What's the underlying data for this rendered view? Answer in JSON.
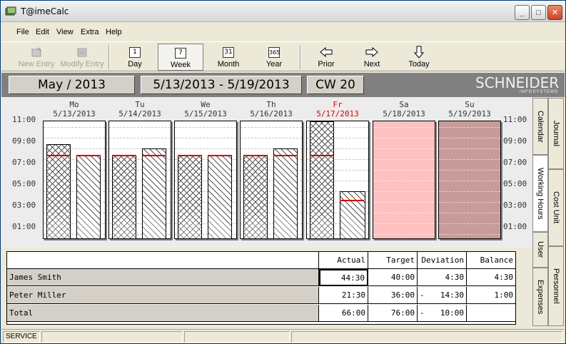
{
  "window": {
    "title": "T@imeCalc"
  },
  "menu": [
    "File",
    "Edit",
    "View",
    "Extra",
    "Help"
  ],
  "toolbar": {
    "new_entry": "New Entry",
    "modify_entry": "Modify Entry",
    "day": "Day",
    "week": "Week",
    "month": "Month",
    "year": "Year",
    "prior": "Prior",
    "next": "Next",
    "today": "Today",
    "day_icon": "1",
    "week_icon": "7",
    "month_icon": "31",
    "year_icon": "365"
  },
  "header": {
    "month": "May / 2013",
    "range": "5/13/2013 - 5/19/2013",
    "cw": "CW 20",
    "logo": "SCHNEIDER",
    "logo_sub": "INFOSYSTEMS"
  },
  "y_axis": [
    "11:00",
    "09:00",
    "07:00",
    "05:00",
    "03:00",
    "01:00"
  ],
  "days": [
    {
      "abbr": "Mo",
      "date": "5/13/2013",
      "actual": 9.0,
      "target": 8.0,
      "today": false,
      "weekend": ""
    },
    {
      "abbr": "Tu",
      "date": "5/14/2013",
      "actual": 8.0,
      "target": 8.0,
      "today": false,
      "weekend": ""
    },
    {
      "abbr": "We",
      "date": "5/15/2013",
      "actual": 8.0,
      "target": 8.0,
      "today": false,
      "weekend": ""
    },
    {
      "abbr": "Th",
      "date": "5/16/2013",
      "actual": 8.0,
      "target": 8.0,
      "today": false,
      "weekend": ""
    },
    {
      "abbr": "Fr",
      "date": "5/17/2013",
      "actual": 11.5,
      "target": 8.0,
      "today": true,
      "weekend": ""
    },
    {
      "abbr": "Sa",
      "date": "5/18/2013",
      "weekend": "sat"
    },
    {
      "abbr": "Su",
      "date": "5/19/2013",
      "weekend": "sun"
    }
  ],
  "side_tabs": {
    "calendar": "Calendar",
    "journal": "Journal",
    "working_hours": "Working Hours",
    "cost_unit": "Cost Unit",
    "user": "User",
    "personnel": "Personnel",
    "expenses": "Expenses"
  },
  "table": {
    "columns": [
      "Actual",
      "Target",
      "Deviation",
      "Balance"
    ],
    "rows": [
      {
        "name": "James Smith",
        "actual": "44:30",
        "target": "40:00",
        "dev_sign": "",
        "deviation": "4:30",
        "balance": "4:30"
      },
      {
        "name": "Peter Miller",
        "actual": "21:30",
        "target": "36:00",
        "dev_sign": "-",
        "deviation": "14:30",
        "balance": "1:00"
      },
      {
        "name": "Total",
        "actual": "66:00",
        "target": "76:00",
        "dev_sign": "-",
        "deviation": "10:00",
        "balance": ""
      }
    ]
  },
  "status": {
    "mode": "SERVICE"
  },
  "colors": {
    "today": "#e00000",
    "target_line": "#d40000",
    "saturday": "#ffc0c0",
    "sunday": "#c89a9a"
  }
}
